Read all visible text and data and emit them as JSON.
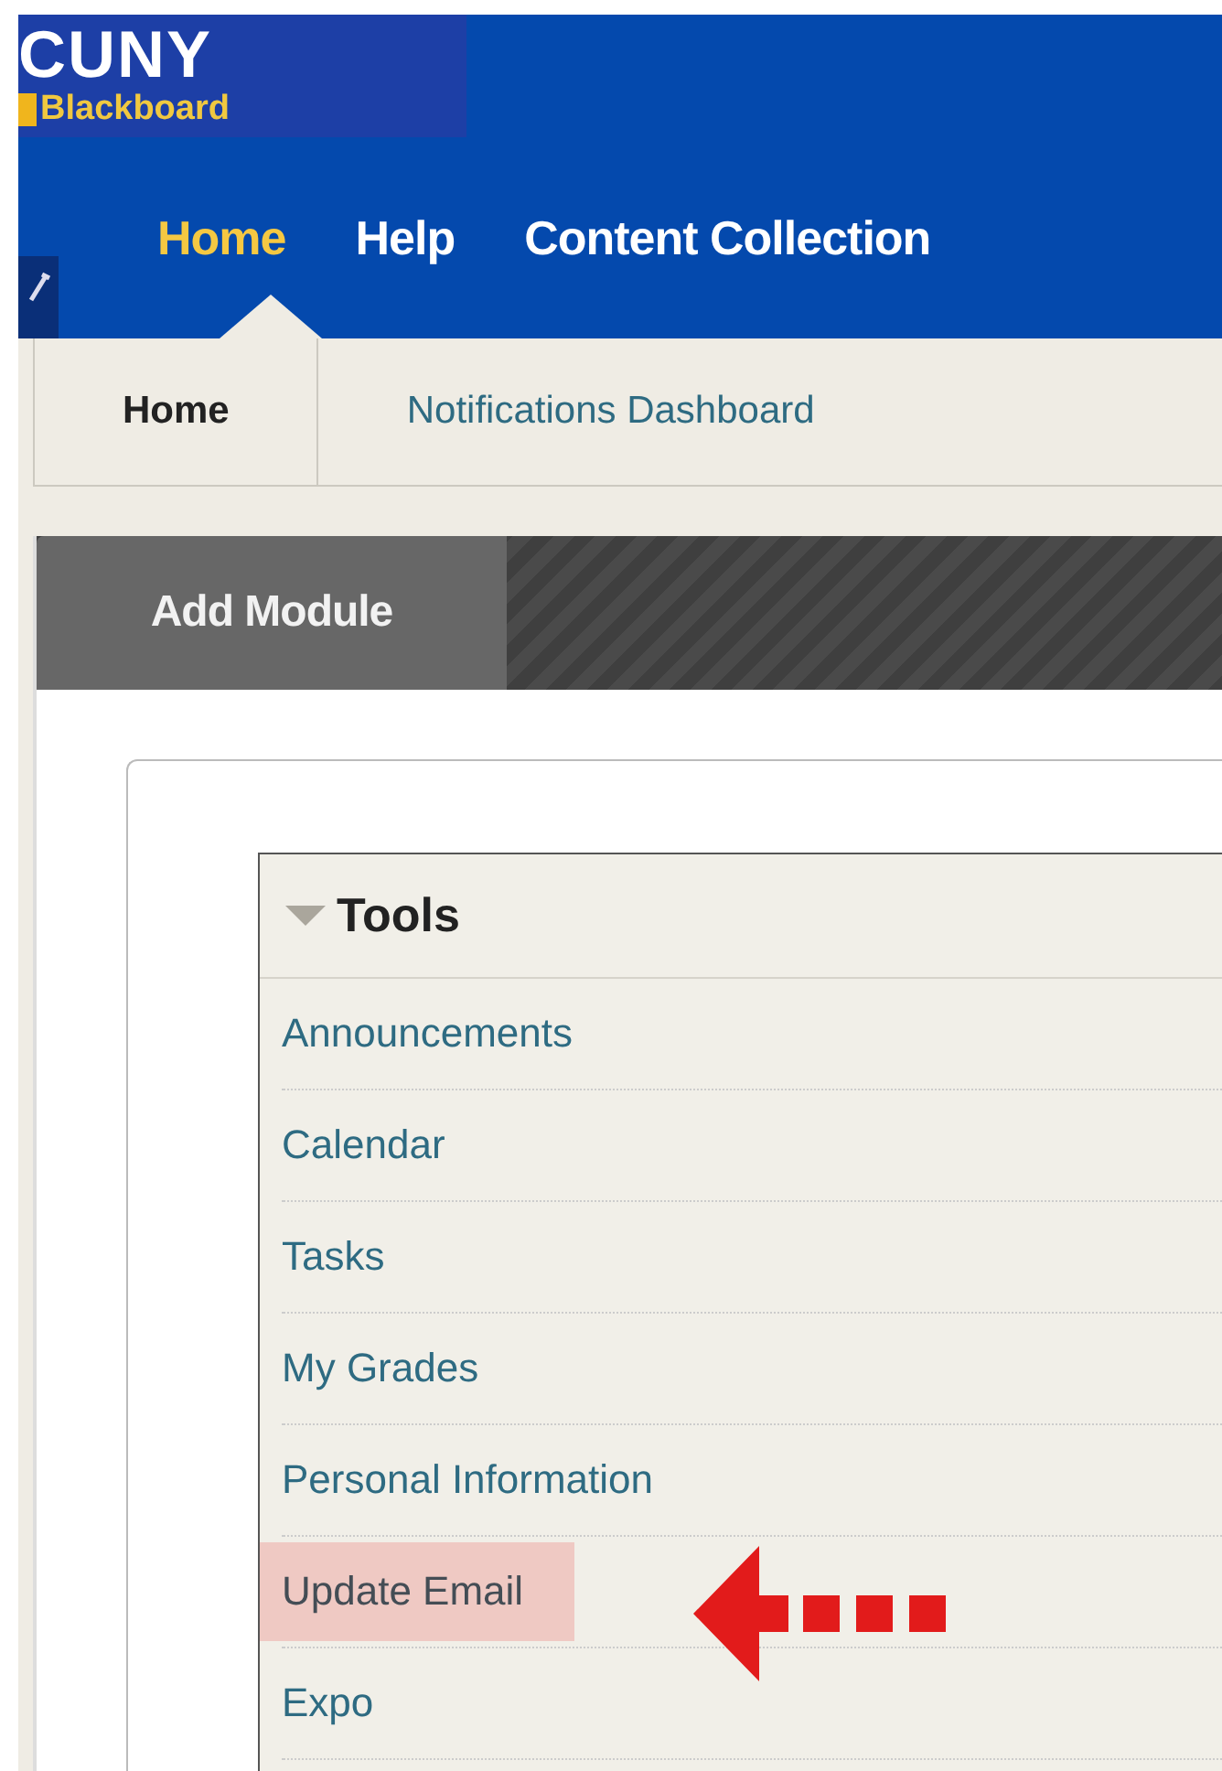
{
  "logo": {
    "title": "CUNY",
    "subtitle": "Blackboard"
  },
  "nav_tabs": [
    {
      "label": "Home",
      "selected": true
    },
    {
      "label": "Help",
      "selected": false
    },
    {
      "label": "Content Collection",
      "selected": false
    }
  ],
  "sub_tabs": [
    {
      "label": "Home",
      "selected": true
    },
    {
      "label": "Notifications Dashboard",
      "selected": false
    }
  ],
  "module_toolbar": {
    "button": "Add Module"
  },
  "tools_module": {
    "title": "Tools",
    "expanded": true,
    "items": [
      {
        "label": "Announcements",
        "highlighted": false,
        "annotated": false
      },
      {
        "label": "Calendar",
        "highlighted": false,
        "annotated": false
      },
      {
        "label": "Tasks",
        "highlighted": false,
        "annotated": false
      },
      {
        "label": "My Grades",
        "highlighted": false,
        "annotated": false
      },
      {
        "label": "Personal Information",
        "highlighted": false,
        "annotated": false
      },
      {
        "label": "Update Email",
        "highlighted": true,
        "annotated": true
      },
      {
        "label": "Expo",
        "highlighted": false,
        "annotated": false
      }
    ]
  }
}
